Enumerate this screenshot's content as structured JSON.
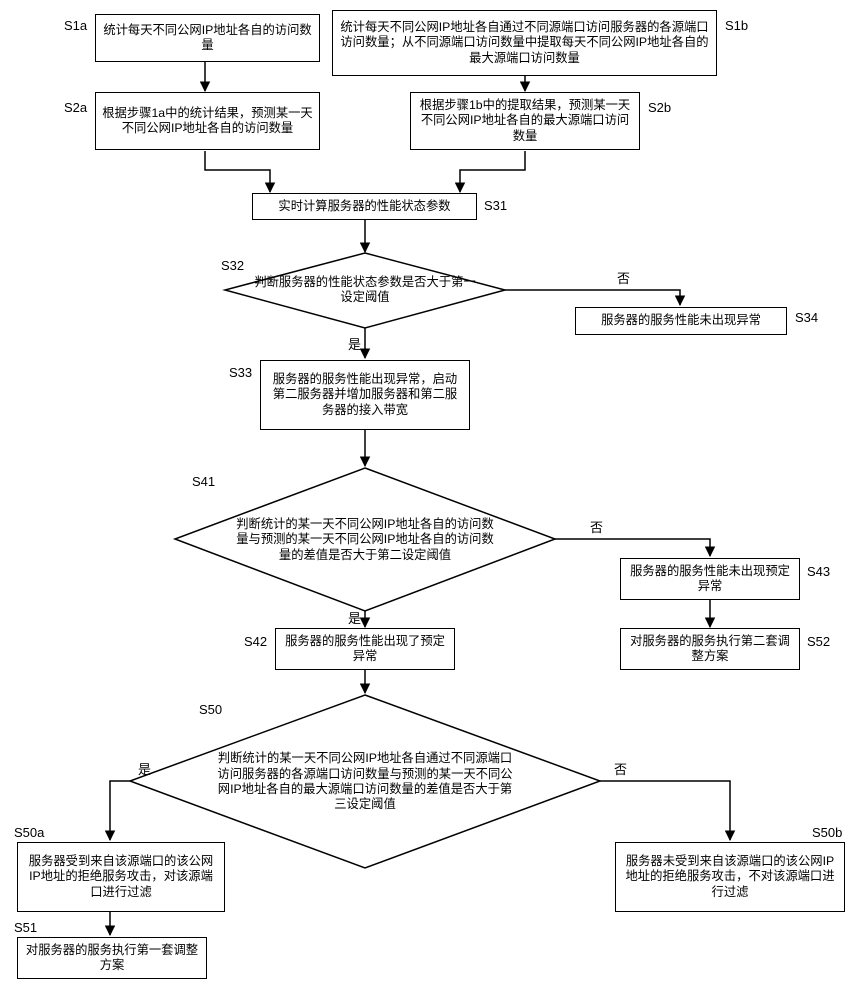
{
  "nodes": {
    "s1a": "统计每天不同公网IP地址各自的访问数量",
    "s1b": "统计每天不同公网IP地址各自通过不同源端口访问服务器的各源端口访问数量；从不同源端口访问数量中提取每天不同公网IP地址各自的最大源端口访问数量",
    "s2a": "根据步骤1a中的统计结果，预测某一天不同公网IP地址各自的访问数量",
    "s2b": "根据步骤1b中的提取结果，预测某一天不同公网IP地址各自的最大源端口访问数量",
    "s31": "实时计算服务器的性能状态参数",
    "s32": "判断服务器的性能状态参数是否大于第一设定阈值",
    "s33": "服务器的服务性能出现异常，启动第二服务器并增加服务器和第二服务器的接入带宽",
    "s34": "服务器的服务性能未出现异常",
    "s41": "判断统计的某一天不同公网IP地址各自的访问数量与预测的某一天不同公网IP地址各自的访问数量的差值是否大于第二设定阈值",
    "s42": "服务器的服务性能出现了预定异常",
    "s43": "服务器的服务性能未出现预定异常",
    "s50": "判断统计的某一天不同公网IP地址各自通过不同源端口访问服务器的各源端口访问数量与预测的某一天不同公网IP地址各自的最大源端口访问数量的差值是否大于第三设定阈值",
    "s50a": "服务器受到来自该源端口的该公网IP地址的拒绝服务攻击，对该源端口进行过滤",
    "s50b": "服务器未受到来自该源端口的该公网IP地址的拒绝服务攻击，不对该源端口进行过滤",
    "s51": "对服务器的服务执行第一套调整方案",
    "s52": "对服务器的服务执行第二套调整方案"
  },
  "step_labels": {
    "s1a": "S1a",
    "s1b": "S1b",
    "s2a": "S2a",
    "s2b": "S2b",
    "s31": "S31",
    "s32": "S32",
    "s33": "S33",
    "s34": "S34",
    "s41": "S41",
    "s42": "S42",
    "s43": "S43",
    "s50": "S50",
    "s50a": "S50a",
    "s50b": "S50b",
    "s51": "S51",
    "s52": "S52"
  },
  "edge_labels": {
    "yes": "是",
    "no": "否"
  }
}
